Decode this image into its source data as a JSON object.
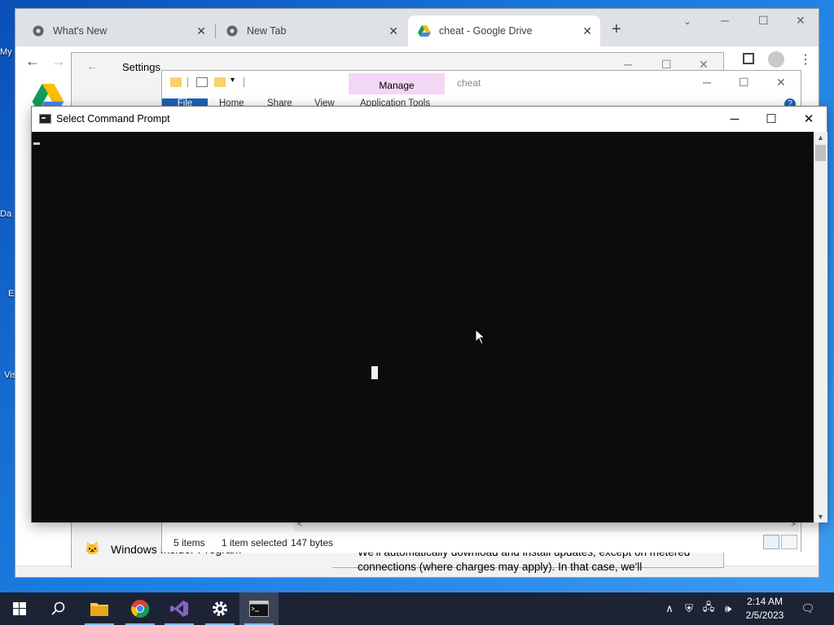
{
  "desktop": {
    "icon_labels": [
      "My",
      "Da",
      "E",
      "Vis"
    ]
  },
  "chrome": {
    "tabs": [
      {
        "label": "What's New"
      },
      {
        "label": "New Tab"
      },
      {
        "label": "cheat - Google Drive"
      }
    ],
    "new_tab": "+",
    "close_glyph": "✕"
  },
  "settings": {
    "title": "Settings",
    "insider_label": "Windows Insider Program",
    "update_text": "We'll automatically download and install updates, except on metered connections (where charges may apply). In that case, we'll"
  },
  "explorer": {
    "manage_tab": "Manage",
    "folder_name": "cheat",
    "ribbon_tabs": [
      "File",
      "Home",
      "Share",
      "View",
      "Application Tools"
    ],
    "status": {
      "items": "5 items",
      "selected": "1 item selected",
      "size": "147 bytes"
    }
  },
  "cmd": {
    "title": "Select Command Prompt",
    "minimize": "─",
    "maximize": "☐",
    "close": "✕"
  },
  "taskbar": {
    "apps": [
      "start",
      "search",
      "file-explorer",
      "chrome",
      "visual-studio",
      "settings",
      "command-prompt"
    ],
    "clock_time": "2:14 AM",
    "clock_date": "2/5/2023"
  },
  "colors": {
    "manage_tab": "#f4d6f7",
    "file_tab": "#1a62b8",
    "console_bg": "#0c0c0c",
    "taskbar": "#1c2334"
  }
}
